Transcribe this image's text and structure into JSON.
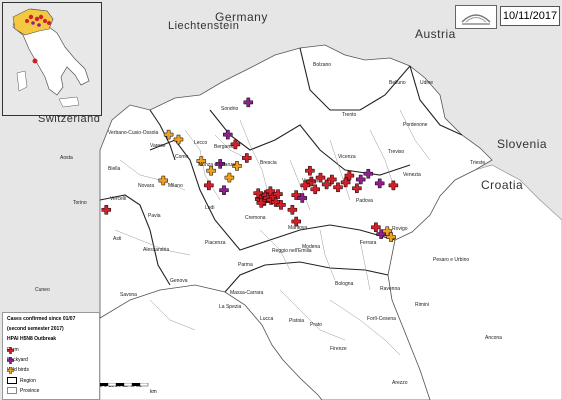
{
  "date": "10/11/2017",
  "countries": {
    "germany": "Germany",
    "liechtenstein": "Liechtenstein",
    "austria": "Austria",
    "switzerland": "Switzerland",
    "slovenia": "Slovenia",
    "croatia": "Croatia"
  },
  "cities": [
    {
      "name": "Bolzano"
    },
    {
      "name": "Belluno"
    },
    {
      "name": "Udine"
    },
    {
      "name": "Trento"
    },
    {
      "name": "Pordenone"
    },
    {
      "name": "Sondrio"
    },
    {
      "name": "Treviso"
    },
    {
      "name": "Verbano-Cusio-Ossola"
    },
    {
      "name": "Lecco"
    },
    {
      "name": "Bergamo"
    },
    {
      "name": "Brescia"
    },
    {
      "name": "Vicenza"
    },
    {
      "name": "Como"
    },
    {
      "name": "Monza e Brianza"
    },
    {
      "name": "Varese"
    },
    {
      "name": "Aosta"
    },
    {
      "name": "Biella"
    },
    {
      "name": "Novara"
    },
    {
      "name": "Milano"
    },
    {
      "name": "Verona"
    },
    {
      "name": "Padova"
    },
    {
      "name": "Venezia"
    },
    {
      "name": "Vercelli"
    },
    {
      "name": "Lodi"
    },
    {
      "name": "Torino"
    },
    {
      "name": "Pavia"
    },
    {
      "name": "Cremona"
    },
    {
      "name": "Mantova"
    },
    {
      "name": "Rovigo"
    },
    {
      "name": "Asti"
    },
    {
      "name": "Alessandria"
    },
    {
      "name": "Piacenza"
    },
    {
      "name": "Ferrara"
    },
    {
      "name": "Modena"
    },
    {
      "name": "Reggio nell'Emilia"
    },
    {
      "name": "Parma"
    },
    {
      "name": "Bologna"
    },
    {
      "name": "Ravenna"
    },
    {
      "name": "Cuneo"
    },
    {
      "name": "Genova"
    },
    {
      "name": "Savona"
    },
    {
      "name": "Massa-Carrara"
    },
    {
      "name": "La Spezia"
    },
    {
      "name": "Forlì-Cesena"
    },
    {
      "name": "Rimini"
    },
    {
      "name": "Lucca"
    },
    {
      "name": "Pistoia"
    },
    {
      "name": "Prato"
    },
    {
      "name": "Firenze"
    },
    {
      "name": "Pesaro e Urbino"
    },
    {
      "name": "Arezzo"
    },
    {
      "name": "Ancona"
    },
    {
      "name": "Trieste"
    }
  ],
  "legend": {
    "line1": "Cases confirmed since 01/07",
    "line2": "(second semester 2017)",
    "line3": "HPAI H5N8 Outbreak",
    "farm": "Farm",
    "backyard": "Backyard",
    "wild_birds": "Wild birds",
    "region": "Region",
    "province": "Province"
  },
  "scale": {
    "ticks": "0 5 10 20 30 40 50",
    "unit": "km"
  },
  "colors": {
    "farm": "#d0202a",
    "backyard": "#8e1f8e",
    "wild_birds": "#f0a020",
    "land": "#ffffff",
    "foreign": "#e6e6e6",
    "sea": "#ffffff"
  },
  "outbreaks": [
    {
      "type": "farm",
      "lat": 45.16,
      "lon": 10.02
    },
    {
      "type": "farm",
      "lat": 45.18,
      "lon": 10.05
    },
    {
      "type": "farm",
      "lat": 45.14,
      "lon": 10.08
    },
    {
      "type": "farm",
      "lat": 45.2,
      "lon": 10.1
    },
    {
      "type": "farm",
      "lat": 45.17,
      "lon": 10.13
    },
    {
      "type": "farm",
      "lat": 45.12,
      "lon": 10.04
    },
    {
      "type": "farm",
      "lat": 45.22,
      "lon": 10.0
    },
    {
      "type": "farm",
      "lat": 45.15,
      "lon": 10.17
    },
    {
      "type": "farm",
      "lat": 45.19,
      "lon": 10.2
    },
    {
      "type": "farm",
      "lat": 45.24,
      "lon": 10.16
    },
    {
      "type": "farm",
      "lat": 45.13,
      "lon": 10.23
    },
    {
      "type": "farm",
      "lat": 45.21,
      "lon": 10.26
    },
    {
      "type": "farm",
      "lat": 45.3,
      "lon": 10.62
    },
    {
      "type": "farm",
      "lat": 45.34,
      "lon": 10.7
    },
    {
      "type": "farm",
      "lat": 45.26,
      "lon": 10.75
    },
    {
      "type": "farm",
      "lat": 45.38,
      "lon": 10.82
    },
    {
      "type": "farm",
      "lat": 45.31,
      "lon": 10.9
    },
    {
      "type": "farm",
      "lat": 45.36,
      "lon": 10.97
    },
    {
      "type": "farm",
      "lat": 45.28,
      "lon": 11.05
    },
    {
      "type": "farm",
      "lat": 45.33,
      "lon": 11.15
    },
    {
      "type": "farm",
      "lat": 45.4,
      "lon": 11.2
    },
    {
      "type": "farm",
      "lat": 45.27,
      "lon": 11.3
    },
    {
      "type": "farm",
      "lat": 45.2,
      "lon": 10.5
    },
    {
      "type": "farm",
      "lat": 45.1,
      "lon": 10.3
    },
    {
      "type": "farm",
      "lat": 45.05,
      "lon": 10.45
    },
    {
      "type": "farm",
      "lat": 44.93,
      "lon": 10.5
    },
    {
      "type": "farm",
      "lat": 45.45,
      "lon": 10.68
    },
    {
      "type": "farm",
      "lat": 45.72,
      "lon": 9.7
    },
    {
      "type": "farm",
      "lat": 45.58,
      "lon": 9.85
    },
    {
      "type": "farm",
      "lat": 45.3,
      "lon": 9.35
    },
    {
      "type": "farm",
      "lat": 44.87,
      "lon": 11.55
    },
    {
      "type": "farm",
      "lat": 45.05,
      "lon": 8.0
    },
    {
      "type": "farm",
      "lat": 45.3,
      "lon": 11.78
    },
    {
      "type": "backyard",
      "lat": 46.15,
      "lon": 9.87
    },
    {
      "type": "backyard",
      "lat": 45.82,
      "lon": 9.6
    },
    {
      "type": "backyard",
      "lat": 45.52,
      "lon": 9.5
    },
    {
      "type": "backyard",
      "lat": 45.25,
      "lon": 9.55
    },
    {
      "type": "backyard",
      "lat": 45.17,
      "lon": 10.58
    },
    {
      "type": "backyard",
      "lat": 45.36,
      "lon": 11.35
    },
    {
      "type": "backyard",
      "lat": 45.42,
      "lon": 11.45
    },
    {
      "type": "backyard",
      "lat": 45.32,
      "lon": 11.6
    },
    {
      "type": "backyard",
      "lat": 44.8,
      "lon": 11.62
    },
    {
      "type": "wild",
      "lat": 45.82,
      "lon": 8.82
    },
    {
      "type": "wild",
      "lat": 45.77,
      "lon": 8.95
    },
    {
      "type": "wild",
      "lat": 45.55,
      "lon": 9.25
    },
    {
      "type": "wild",
      "lat": 45.45,
      "lon": 9.38
    },
    {
      "type": "wild",
      "lat": 45.38,
      "lon": 9.62
    },
    {
      "type": "wild",
      "lat": 45.5,
      "lon": 9.72
    },
    {
      "type": "wild",
      "lat": 45.35,
      "lon": 8.75
    },
    {
      "type": "wild",
      "lat": 44.83,
      "lon": 11.7
    },
    {
      "type": "wild",
      "lat": 44.77,
      "lon": 11.75
    }
  ]
}
